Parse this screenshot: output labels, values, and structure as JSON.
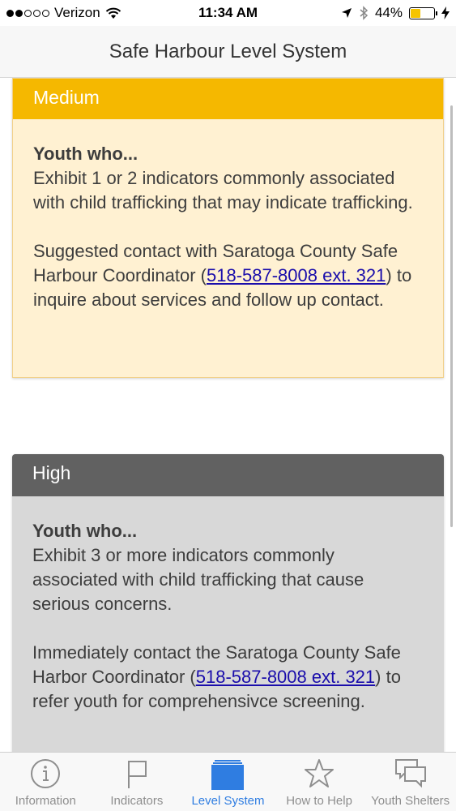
{
  "status_bar": {
    "carrier": "Verizon",
    "time": "11:34 AM",
    "battery_percent": "44%",
    "battery_level": 0.44,
    "signal_bars_filled": 2,
    "signal_bars_total": 5
  },
  "nav": {
    "title": "Safe Harbour Level System"
  },
  "levels": {
    "medium": {
      "title": "Medium",
      "heading": "Youth who...",
      "description": "Exhibit 1 or 2 indicators commonly associated with child trafficking that may indicate trafficking.",
      "action_before": "Suggested contact with Saratoga County Safe Harbour Coordinator (",
      "phone": "518-587-8008 ext. 321",
      "action_after": ") to inquire about services and follow up contact.",
      "colors": {
        "header": "#f5b800",
        "body": "#fff1d2"
      }
    },
    "high": {
      "title": "High",
      "heading": "Youth who...",
      "description": "Exhibit 3 or more indicators commonly associated with child trafficking that cause serious concerns.",
      "action_before": "Immediately contact the Saratoga County Safe Harbor Coordinator (",
      "phone": "518-587-8008 ext. 321",
      "action_after": ") to refer youth for comprehensivce screening.",
      "colors": {
        "header": "#616161",
        "body": "#d8d8d8"
      }
    }
  },
  "tabs": [
    {
      "label": "Information",
      "icon": "info-icon",
      "active": false
    },
    {
      "label": "Indicators",
      "icon": "flag-icon",
      "active": false
    },
    {
      "label": "Level System",
      "icon": "stack-icon",
      "active": true
    },
    {
      "label": "How to Help",
      "icon": "star-icon",
      "active": false
    },
    {
      "label": "Youth Shelters",
      "icon": "chat-icon",
      "active": false
    }
  ],
  "colors": {
    "accent": "#2f7de1",
    "tab_inactive": "#8e8e8e"
  }
}
